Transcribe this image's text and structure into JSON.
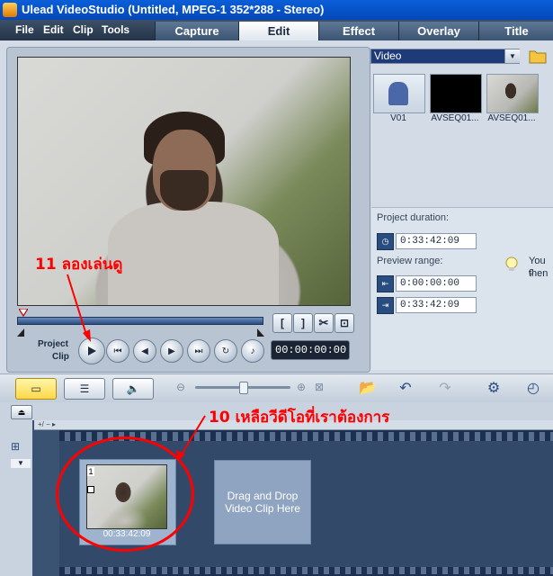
{
  "window": {
    "title": "Ulead VideoStudio (Untitled, MPEG-1 352*288 - Stereo)"
  },
  "menu": [
    "File",
    "Edit",
    "Clip",
    "Tools"
  ],
  "tabs": [
    {
      "label": "Capture",
      "active": false
    },
    {
      "label": "Edit",
      "active": true
    },
    {
      "label": "Effect",
      "active": false
    },
    {
      "label": "Overlay",
      "active": false
    },
    {
      "label": "Title",
      "active": false
    }
  ],
  "preview": {
    "mode_project": "Project",
    "mode_clip": "Clip",
    "timecode": "00:00:00:00",
    "mark_in": "[",
    "mark_out": "]"
  },
  "library": {
    "category": "Video",
    "thumbnails": [
      {
        "label": "V01"
      },
      {
        "label": "AVSEQ01..."
      },
      {
        "label": "AVSEQ01..."
      }
    ]
  },
  "info": {
    "project_duration_label": "Project duration:",
    "project_duration": "0:33:42:09",
    "preview_range_label": "Preview range:",
    "range_start": "0:00:00:00",
    "range_end": "0:33:42:09",
    "tip_line1": "You c",
    "tip_line2": "then"
  },
  "timeline": {
    "ruler": "+/ − ▸",
    "clip_number": "1",
    "clip_duration": "00:33:42:09",
    "drop_text": "Drag and Drop Video Clip Here"
  },
  "annotations": {
    "step11": "11 ลองเล่นดู",
    "step10": "10 เหลือวีดีโอที่เราต้องการ",
    "color": "#ff0000"
  },
  "colors": {
    "titlebar": "#0447b8",
    "tabbar": "#243448",
    "accent": "#ffd84a"
  }
}
